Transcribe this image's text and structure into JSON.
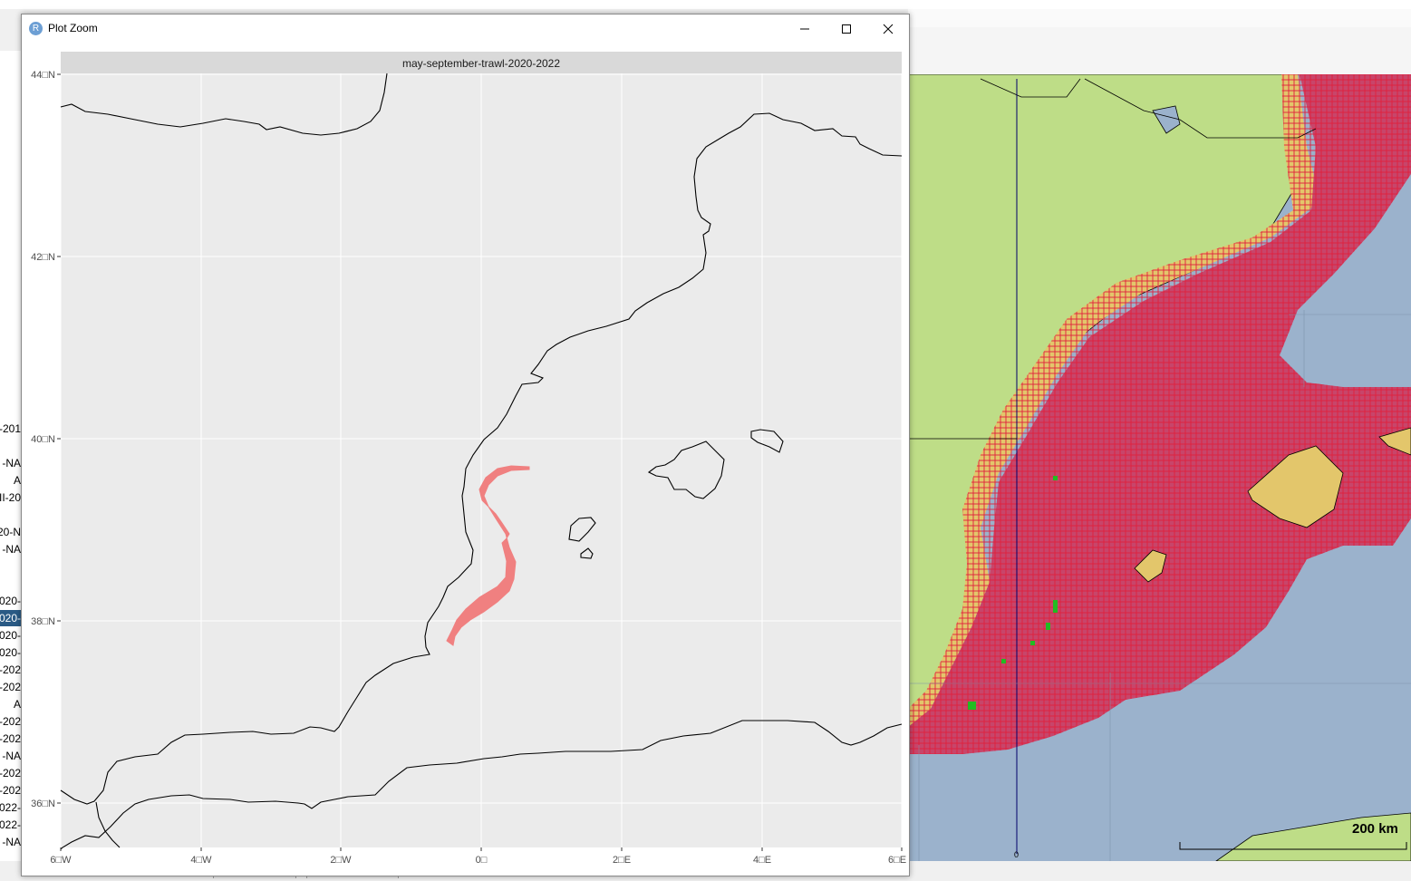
{
  "window": {
    "title": "Plot Zoom",
    "icon_letter": "R",
    "minimize_icon": "minimize-icon",
    "maximize_icon": "maximize-icon",
    "close_icon": "close-icon"
  },
  "plot": {
    "facet_strip": "may-september-trawl-2020-2022",
    "y_tick_labels": [
      "44□N",
      "42□N",
      "40□N",
      "38□N",
      "36□N"
    ],
    "x_tick_labels": [
      "6□W",
      "4□W",
      "2□W",
      "0□",
      "2□E",
      "4□E",
      "6□E"
    ],
    "panel_color": "#ebebeb",
    "strip_color": "#d9d9d9",
    "grid_color": "#ffffff",
    "coast_color": "#000000",
    "polygon_color": "#f08080"
  },
  "background_app": {
    "list_items": [
      "-201",
      "",
      "-NA",
      "A",
      "II-20",
      "",
      "20-N",
      "-NA",
      "",
      "",
      "020-",
      "020-",
      "020-",
      "020-",
      "-202",
      "-202",
      "A",
      "-202",
      "-202",
      "-NA",
      "-202",
      "-202",
      "022-",
      "022-",
      "-NA"
    ],
    "selected_index": 11,
    "scale_bar_label": "200 km",
    "axis_label": "0",
    "land_color": "#bedd87",
    "sea_color": "#9bb2cc",
    "cell_color": "#e01f3c",
    "cell_fill": "#c8456a",
    "shelf_fill": "#e3c66b",
    "point_color": "#22bb22"
  }
}
